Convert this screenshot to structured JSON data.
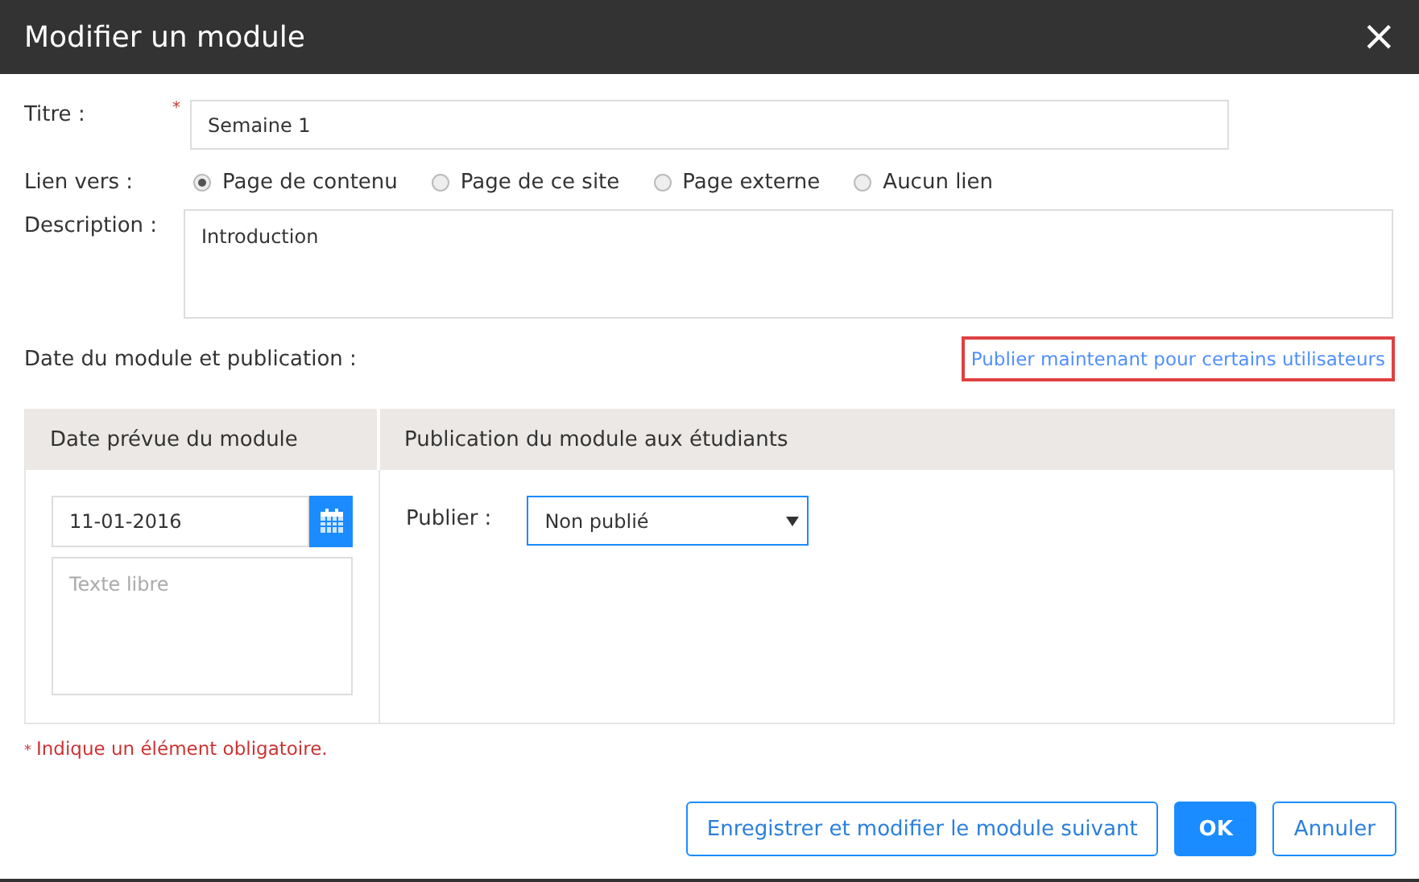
{
  "window": {
    "title": "Modifier un module",
    "close": "×"
  },
  "title_field": {
    "label": "Titre :",
    "required_mark": "*",
    "value": "Semaine 1"
  },
  "link_to": {
    "label": "Lien vers :",
    "options": [
      {
        "label": "Page de contenu",
        "selected": true
      },
      {
        "label": "Page de ce site",
        "selected": false
      },
      {
        "label": "Page externe",
        "selected": false
      },
      {
        "label": "Aucun lien",
        "selected": false
      }
    ]
  },
  "description": {
    "label": "Description :",
    "value": "Introduction"
  },
  "date_section": {
    "label": "Date du module et publication :",
    "link": "Publier maintenant pour certains utilisateurs"
  },
  "panel": {
    "columns": [
      "Date prévue du module",
      "Publication du module aux étudiants"
    ],
    "date": {
      "value": "11-01-2016"
    },
    "free_text": {
      "placeholder": "Texte libre"
    },
    "publish": {
      "label": "Publier :",
      "value": "Non publié"
    }
  },
  "required_note": {
    "mark": "*",
    "text": "Indique un élément obligatoire."
  },
  "buttons": [
    {
      "label": "Enregistrer et modifier le module suivant",
      "kind": "secondary"
    },
    {
      "label": "OK",
      "kind": "primary"
    },
    {
      "label": "Annuler",
      "kind": "secondary"
    }
  ]
}
